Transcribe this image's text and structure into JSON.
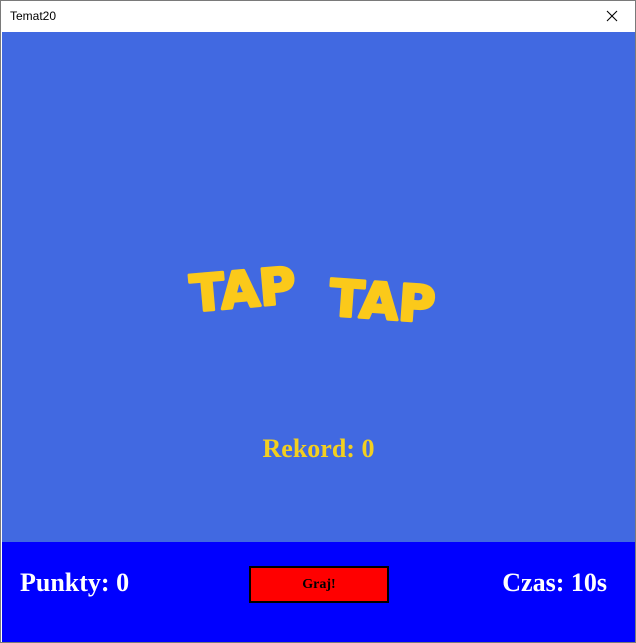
{
  "window": {
    "title": "Temat20",
    "close_icon": "close-icon"
  },
  "game": {
    "logo_text": [
      "TAP",
      "TAP"
    ],
    "record_label": "Rekord: 0"
  },
  "bottom_bar": {
    "score_label": "Punkty: 0",
    "play_button_label": "Graj!",
    "time_label": "Czas: 10s"
  },
  "colors": {
    "game_background": "#4169e1",
    "bottom_bar_background": "#0000ff",
    "logo_color": "#fbc91a",
    "record_color": "#f2cf20",
    "play_button_color": "#ff0000"
  }
}
